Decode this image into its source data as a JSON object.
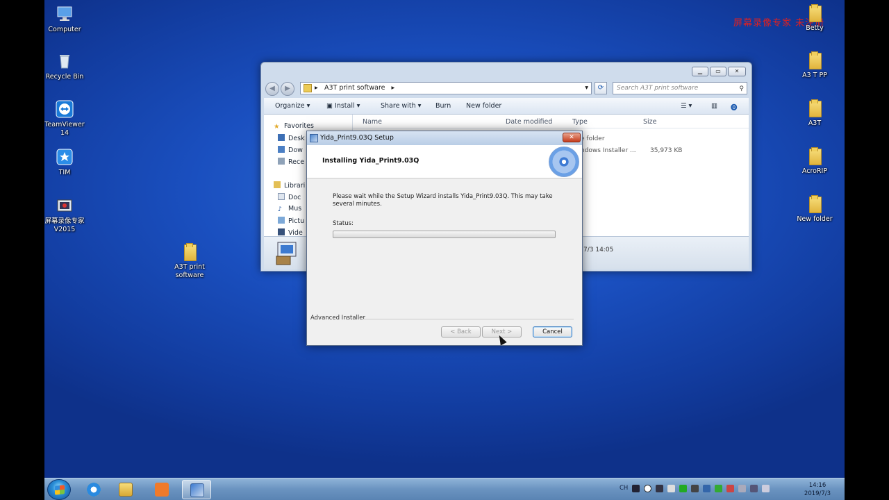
{
  "watermark": "屏幕录像专家  未注册",
  "desktop_icons": {
    "computer": "Computer",
    "recycle_bin": "Recycle Bin",
    "teamviewer": "TeamViewer 14",
    "tim": "TIM",
    "screen_recorder": "屏幕录像专家V2015",
    "a3t_print_software": "A3T print software",
    "betty": "Betty",
    "a3tpp": "A3 T PP",
    "a3t": "A3T",
    "acrorip": "AcroRIP",
    "new_folder": "New folder"
  },
  "explorer": {
    "breadcrumb": "A3T print software",
    "search_placeholder": "Search A3T print software",
    "toolbar": {
      "organize": "Organize",
      "install": "Install",
      "share_with": "Share with",
      "burn": "Burn",
      "new_folder": "New folder"
    },
    "nav": {
      "favorites": "Favorites",
      "desktop": "Desk",
      "downloads": "Dow",
      "recent": "Rece",
      "libraries": "Librari",
      "documents": "Doc",
      "music": "Mus",
      "pictures": "Pictu",
      "videos": "Vide"
    },
    "columns": {
      "name": "Name",
      "date_modified": "Date modified",
      "type": "Type",
      "size": "Size"
    },
    "rows": [
      {
        "type": "e folder",
        "size": ""
      },
      {
        "type": "ndows Installer ...",
        "size": "35,973 KB"
      }
    ],
    "details_date": "7/3 14:05"
  },
  "setup_dialog": {
    "title": "Yida_Print9.03Q Setup",
    "heading": "Installing Yida_Print9.03Q",
    "message": "Please wait while the Setup Wizard installs Yida_Print9.03Q.  This may take several minutes.",
    "status_label": "Status:",
    "progress": 0.0,
    "footer_brand": "Advanced Installer",
    "buttons": {
      "back": "< Back",
      "next": "Next >",
      "cancel": "Cancel"
    }
  },
  "taskbar": {
    "lang": "CH",
    "time": "14:16",
    "date": "2019/7/3"
  },
  "colors": {
    "desktop": "#1a4fbf",
    "accent": "#3a7bc0",
    "watermark": "#e02020"
  }
}
